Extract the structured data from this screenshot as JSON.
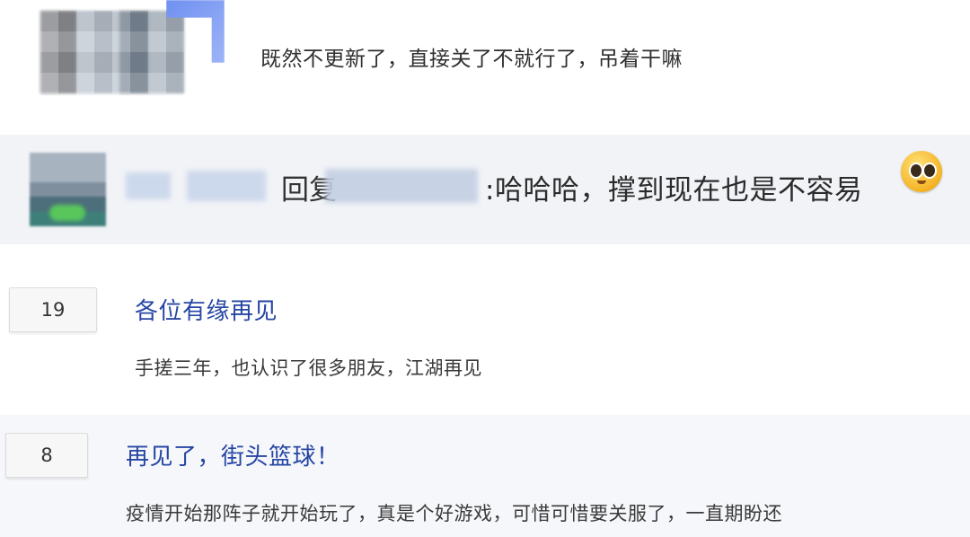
{
  "comment": {
    "text": "既然不更新了，直接关了不就行了，吊着干嘛"
  },
  "reply": {
    "prefix": "回复",
    "text": ":哈哈哈，撑到现在也是不容易",
    "emoji": "pleading-face-emoji"
  },
  "posts": [
    {
      "count": "19",
      "title": "各位有缘再见",
      "body": "手搓三年，也认识了很多朋友，江湖再见"
    },
    {
      "count": "8",
      "title": "再见了，街头篮球！",
      "body": "疫情开始那阵子就开始玩了，真是个好游戏，可惜可惜要关服了，一直期盼还"
    }
  ],
  "colors": {
    "title_blue": "#2646a4",
    "reply_bg": "#f1f3f7"
  }
}
